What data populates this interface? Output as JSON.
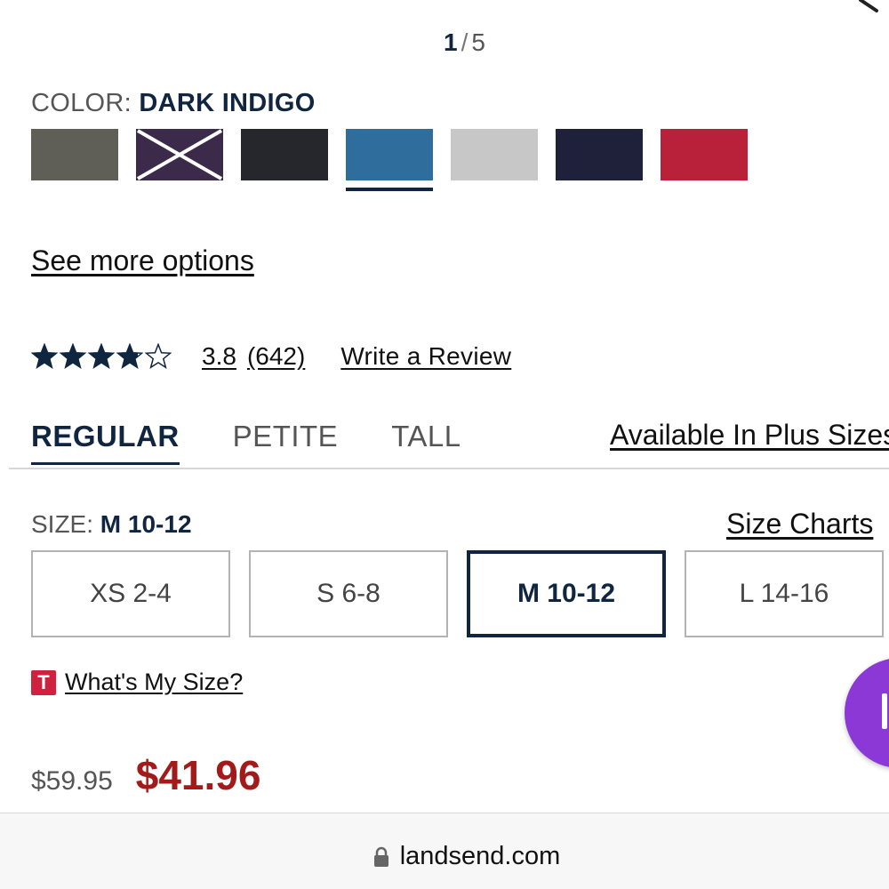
{
  "pager": {
    "current": "1",
    "separator": "/",
    "total": "5"
  },
  "color": {
    "label": "COLOR:",
    "selected": "DARK INDIGO",
    "swatches": [
      {
        "name": "gray-heather",
        "hex": "#5f5e57",
        "available": true,
        "selected": false
      },
      {
        "name": "purple",
        "hex": "#3c2a4a",
        "available": false,
        "selected": false
      },
      {
        "name": "black",
        "hex": "#26272d",
        "available": true,
        "selected": false
      },
      {
        "name": "blue",
        "hex": "#2f6e9c",
        "available": true,
        "selected": true
      },
      {
        "name": "light-gray-heather",
        "hex": "#c7c7c7",
        "available": true,
        "selected": false
      },
      {
        "name": "navy",
        "hex": "#1e2139",
        "available": true,
        "selected": false
      },
      {
        "name": "red",
        "hex": "#b9203a",
        "available": true,
        "selected": false
      }
    ]
  },
  "see_more": "See more options",
  "rating": {
    "stars": 3.8,
    "value": "3.8",
    "count": "(642)",
    "write_review": "Write a Review"
  },
  "fit_tabs": [
    {
      "label": "REGULAR",
      "active": true
    },
    {
      "label": "PETITE",
      "active": false
    },
    {
      "label": "TALL",
      "active": false
    }
  ],
  "plus_sizes_link": "Available In Plus Sizes",
  "size": {
    "label": "SIZE:",
    "selected": "M 10-12",
    "charts_link": "Size Charts",
    "options": [
      {
        "label": "XS 2-4",
        "selected": false
      },
      {
        "label": "S 6-8",
        "selected": false
      },
      {
        "label": "M 10-12",
        "selected": true
      },
      {
        "label": "L 14-16",
        "selected": false
      }
    ]
  },
  "whats_my_size": {
    "icon_letter": "T",
    "label": "What's My Size?"
  },
  "price": {
    "original": "$59.95",
    "sale": "$41.96"
  },
  "browser": {
    "url": "landsend.com"
  },
  "colors": {
    "navy": "#0f2540",
    "sale_red": "#a21a1a",
    "chat_purple": "#8b38d6"
  }
}
